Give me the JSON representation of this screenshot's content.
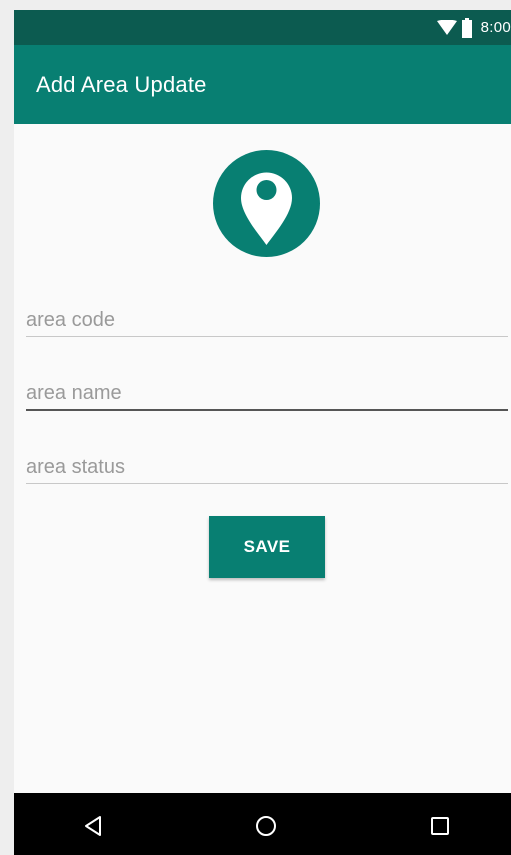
{
  "status_bar": {
    "time": "8:00",
    "icons": [
      "wifi-icon",
      "battery-icon"
    ]
  },
  "app_bar": {
    "title": "Add Area Update"
  },
  "logo": {
    "icon": "location-pin-icon",
    "color": "#087f72"
  },
  "form": {
    "area_code": {
      "value": "",
      "placeholder": "area code"
    },
    "area_name": {
      "value": "",
      "placeholder": "area name"
    },
    "area_status": {
      "value": "",
      "placeholder": "area status"
    },
    "save_label": "SAVE"
  },
  "nav_bar": {
    "buttons": [
      "back-icon",
      "home-icon",
      "recents-icon"
    ]
  },
  "colors": {
    "primary": "#087f72",
    "primary_dark": "#0c5b50",
    "background": "#fafafa"
  }
}
